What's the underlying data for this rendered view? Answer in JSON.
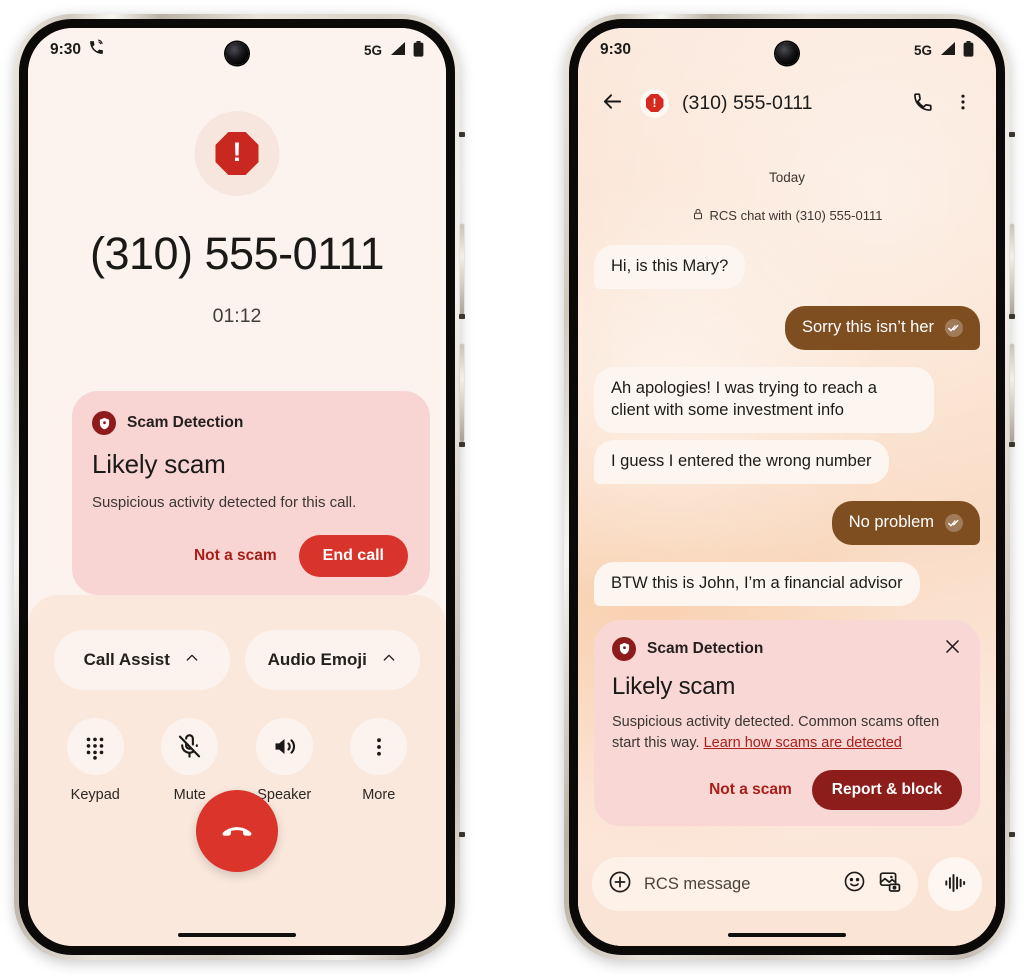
{
  "left_phone": {
    "status_bar": {
      "time": "9:30",
      "call_icon": "phone-in-call-icon",
      "network": "5G",
      "signal_icon": "signal-bars-icon",
      "battery_icon": "battery-full-icon"
    },
    "warning_icon": "octagon-alert-icon",
    "caller_number": "(310) 555-0111",
    "call_duration": "01:12",
    "scam_card": {
      "badge_icon": "shield-scam-icon",
      "header": "Scam Detection",
      "title": "Likely scam",
      "body": "Suspicious activity detected for this call.",
      "secondary_action": "Not a scam",
      "primary_action": "End call",
      "card_bg": "#f8d5d3",
      "primary_color": "#d9342b",
      "secondary_color": "#a81f1a"
    },
    "assist_chips": [
      {
        "label": "Call Assist",
        "icon": "chevron-up-icon"
      },
      {
        "label": "Audio Emoji",
        "icon": "chevron-up-icon"
      }
    ],
    "controls": [
      {
        "label": "Keypad",
        "icon": "dialpad-icon"
      },
      {
        "label": "Mute",
        "icon": "mic-off-icon"
      },
      {
        "label": "Speaker",
        "icon": "speaker-icon"
      },
      {
        "label": "More",
        "icon": "more-vertical-icon"
      }
    ],
    "end_call": {
      "icon": "call-end-icon",
      "color": "#da342b"
    }
  },
  "right_phone": {
    "status_bar": {
      "time": "9:30",
      "network": "5G",
      "signal_icon": "signal-bars-icon",
      "battery_icon": "battery-full-icon"
    },
    "app_bar": {
      "back_icon": "arrow-back-icon",
      "avatar_icon": "octagon-alert-icon",
      "title": "(310) 555-0111",
      "call_icon": "phone-call-icon",
      "overflow_icon": "more-vertical-icon"
    },
    "day_separator": "Today",
    "rcs_note": {
      "lock_icon": "lock-icon",
      "text": "RCS chat with (310) 555-0111"
    },
    "messages": [
      {
        "side": "in",
        "text": "Hi, is this Mary?"
      },
      {
        "side": "out",
        "text": "Sorry this isn’t her",
        "status_icon": "double-check-icon"
      },
      {
        "side": "in",
        "text": "Ah apologies! I was trying to reach a client with some investment info"
      },
      {
        "side": "in",
        "text": "I guess I entered the wrong number"
      },
      {
        "side": "out",
        "text": "No problem",
        "status_icon": "double-check-icon"
      },
      {
        "side": "in",
        "text": "BTW this is John, I’m a financial advisor"
      }
    ],
    "scam_card": {
      "badge_icon": "shield-scam-icon",
      "header": "Scam Detection",
      "close_icon": "close-icon",
      "title": "Likely scam",
      "body_text": "Suspicious activity detected. Common scams often start this way. ",
      "body_link": "Learn how scams are detected",
      "secondary_action": "Not a scam",
      "primary_action": "Report & block",
      "card_bg": "#f8d7d4",
      "primary_color": "#8d1d1b"
    },
    "compose": {
      "add_icon": "plus-circle-icon",
      "placeholder": "RCS message",
      "emoji_icon": "emoji-smile-icon",
      "gallery_icon": "gallery-camera-icon",
      "mic_icon": "audio-waveform-icon"
    }
  }
}
